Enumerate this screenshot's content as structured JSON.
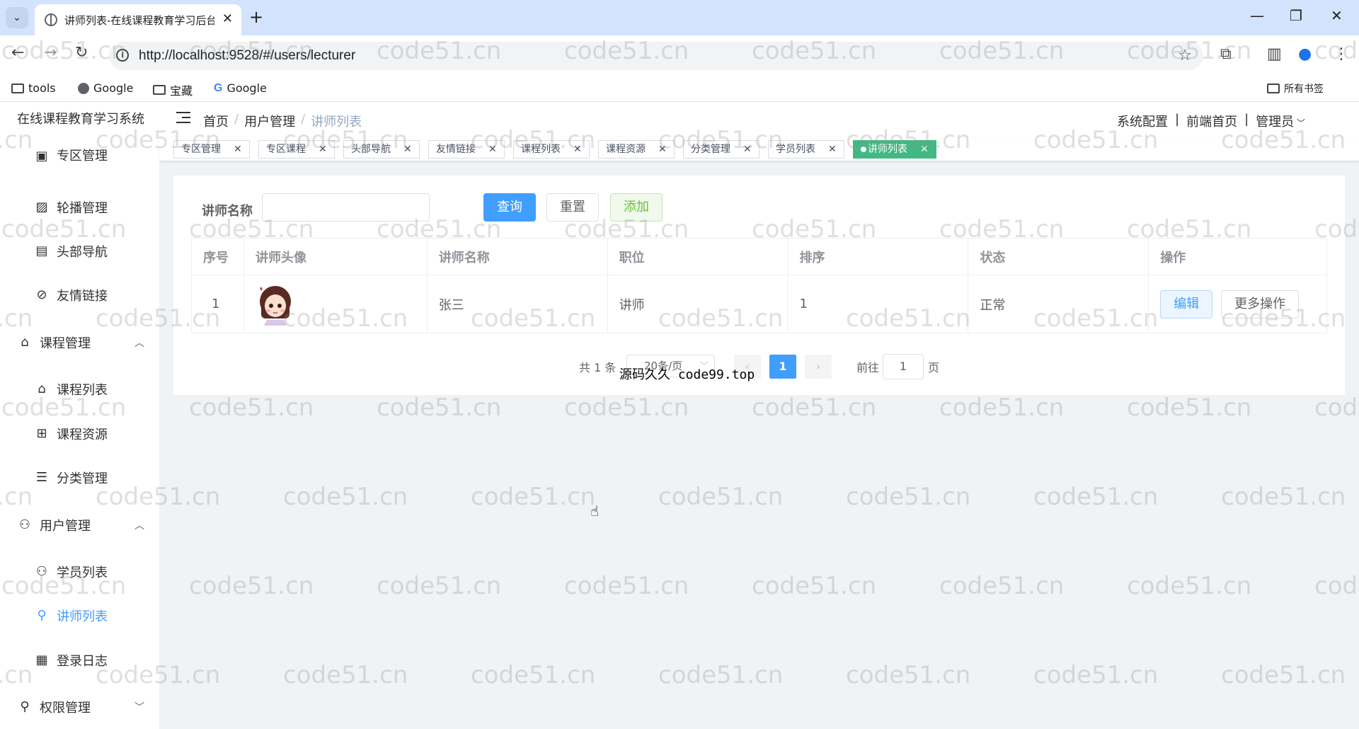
{
  "browser": {
    "tab_title": "讲师列表-在线课程教育学习后台",
    "url": "http://localhost:9528/#/users/lecturer",
    "bookmarks": [
      {
        "label": "tools",
        "icon": "folder-icon"
      },
      {
        "label": "Google",
        "icon": "globe-icon"
      },
      {
        "label": "宝藏",
        "icon": "folder-icon"
      },
      {
        "label": "Google",
        "icon": "google-icon"
      }
    ],
    "all_bookmarks": "所有书签"
  },
  "app": {
    "logo_title": "在线课程教育学习系统",
    "sidebar": {
      "items": [
        {
          "label": "专区管理",
          "icon": "zone-icon"
        },
        {
          "label": "轮播管理",
          "icon": "image-icon"
        },
        {
          "label": "头部导航",
          "icon": "calendar-icon"
        },
        {
          "label": "友情链接",
          "icon": "link-icon"
        },
        {
          "label": "课程管理",
          "icon": "graduation-cap-icon"
        },
        {
          "label": "课程列表",
          "icon": "graduation-cap-icon"
        },
        {
          "label": "课程资源",
          "icon": "grid-icon"
        },
        {
          "label": "分类管理",
          "icon": "list-icon"
        },
        {
          "label": "用户管理",
          "icon": "users-icon"
        },
        {
          "label": "学员列表",
          "icon": "users-icon"
        },
        {
          "label": "讲师列表",
          "icon": "user-icon"
        },
        {
          "label": "登录日志",
          "icon": "document-icon"
        },
        {
          "label": "权限管理",
          "icon": "person-icon"
        }
      ]
    },
    "breadcrumb": [
      "首页",
      "用户管理",
      "讲师列表"
    ],
    "header_right": [
      "系统配置",
      "前端首页",
      "管理员"
    ],
    "tags": [
      "专区管理",
      "专区课程",
      "头部导航",
      "友情链接",
      "课程列表",
      "课程资源",
      "分类管理",
      "学员列表",
      "讲师列表"
    ],
    "search": {
      "label": "讲师名称",
      "value": "",
      "query_btn": "查询",
      "reset_btn": "重置",
      "add_btn": "添加"
    },
    "table": {
      "columns": [
        "序号",
        "讲师头像",
        "讲师名称",
        "职位",
        "排序",
        "状态",
        "操作"
      ],
      "rows": [
        {
          "index": "1",
          "name": "张三",
          "position": "讲师",
          "sort": "1",
          "status": "正常",
          "edit": "编辑",
          "more": "更多操作"
        }
      ]
    },
    "pagination": {
      "total": "共 1 条",
      "page_size": "20条/页",
      "current_page": "1",
      "goto_label": "前往",
      "goto_value": "1",
      "page_suffix": "页"
    },
    "overlay_text": "源码久久 code99.top",
    "watermark": "code51.cn"
  },
  "colors": {
    "primary": "#409eff",
    "tag_active": "#42b983",
    "success": "#67c23a"
  }
}
